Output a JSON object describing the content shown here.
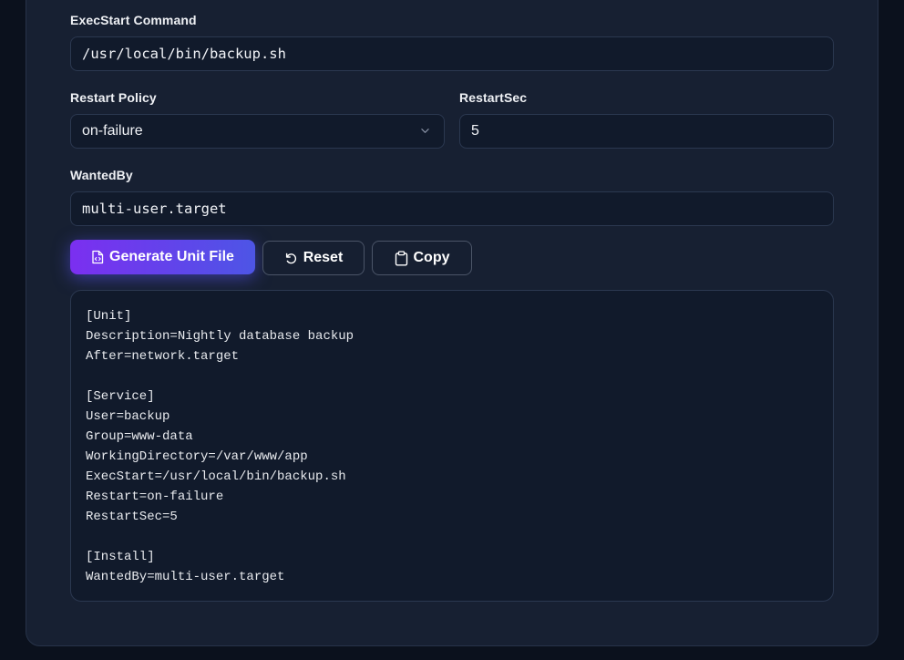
{
  "form": {
    "exec_start": {
      "label": "ExecStart Command",
      "value": "/usr/local/bin/backup.sh"
    },
    "restart_policy": {
      "label": "Restart Policy",
      "value": "on-failure"
    },
    "restart_sec": {
      "label": "RestartSec",
      "value": "5"
    },
    "wanted_by": {
      "label": "WantedBy",
      "value": "multi-user.target"
    }
  },
  "actions": {
    "generate_label": "Generate Unit File",
    "reset_label": "Reset",
    "copy_label": "Copy"
  },
  "output": {
    "text": "[Unit]\nDescription=Nightly database backup\nAfter=network.target\n\n[Service]\nUser=backup\nGroup=www-data\nWorkingDirectory=/var/www/app\nExecStart=/usr/local/bin/backup.sh\nRestart=on-failure\nRestartSec=5\n\n[Install]\nWantedBy=multi-user.target"
  },
  "icons": {
    "generate": "file-code-icon",
    "reset": "rotate-ccw-icon",
    "copy": "clipboard-icon",
    "select": "chevron-down-icon"
  },
  "colors": {
    "background": "#0b111d",
    "panel": "#172032",
    "input_bg": "#111a2b",
    "accent_start": "#7b2ff0",
    "accent_end": "#4d55e6"
  }
}
